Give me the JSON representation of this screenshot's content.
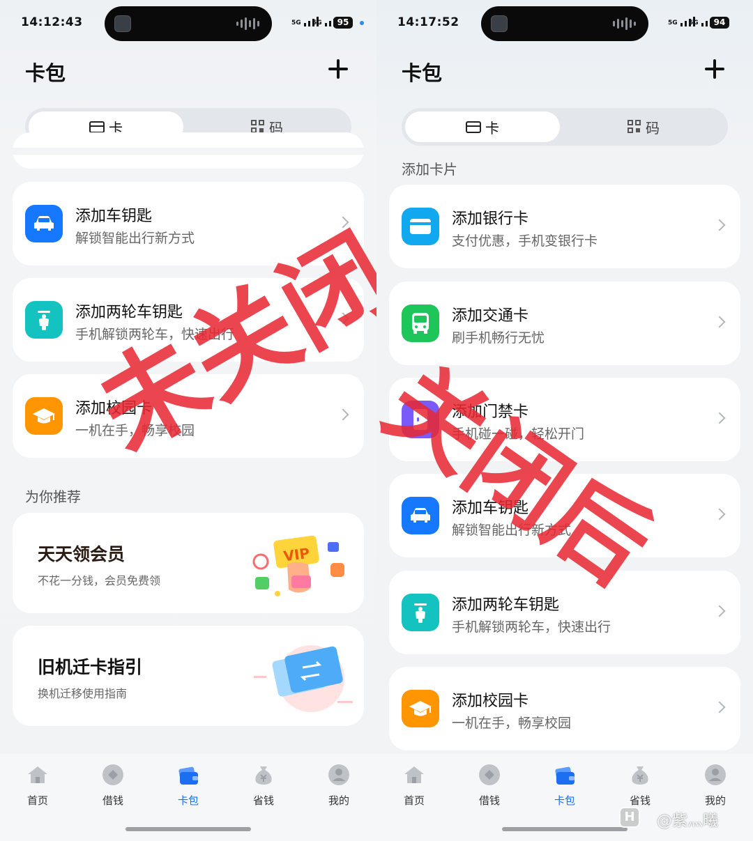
{
  "left": {
    "time": "14:12:43",
    "battery": "95",
    "title": "卡包",
    "segment": {
      "card": "卡",
      "code": "码"
    },
    "items": [
      {
        "title": "添加车钥匙",
        "subtitle": "解锁智能出行新方式",
        "icon": "car-icon",
        "color": "#1677ff"
      },
      {
        "title": "添加两轮车钥匙",
        "subtitle": "手机解锁两轮车，快速出行",
        "icon": "scooter-icon",
        "color": "#14c2c0"
      },
      {
        "title": "添加校园卡",
        "subtitle": "一机在手，畅享校园",
        "icon": "graduation-cap-icon",
        "color": "#ff9500"
      }
    ],
    "recommend_title": "为你推荐",
    "promos": [
      {
        "title": "天天领会员",
        "subtitle": "不花一分钱，会员免费领",
        "badge": "VIP"
      },
      {
        "title": "旧机迁卡指引",
        "subtitle": "换机迁移使用指南"
      }
    ],
    "stamp": "未关闭"
  },
  "right": {
    "time": "14:17:52",
    "battery": "94",
    "title": "卡包",
    "segment": {
      "card": "卡",
      "code": "码"
    },
    "section_title": "添加卡片",
    "items": [
      {
        "title": "添加银行卡",
        "subtitle": "支付优惠，手机变银行卡",
        "icon": "bank-card-icon",
        "color": "#12a8ef"
      },
      {
        "title": "添加交通卡",
        "subtitle": "刷手机畅行无忧",
        "icon": "bus-icon",
        "color": "#1dc55a"
      },
      {
        "title": "添加门禁卡",
        "subtitle": "手机碰一碰，轻松开门",
        "icon": "door-icon",
        "color": "#7a5af8"
      },
      {
        "title": "添加车钥匙",
        "subtitle": "解锁智能出行新方式",
        "icon": "car-icon",
        "color": "#1677ff"
      },
      {
        "title": "添加两轮车钥匙",
        "subtitle": "手机解锁两轮车，快速出行",
        "icon": "scooter-icon",
        "color": "#14c2c0"
      },
      {
        "title": "添加校园卡",
        "subtitle": "一机在手，畅享校园",
        "icon": "graduation-cap-icon",
        "color": "#ff9500"
      }
    ],
    "stamp": "关闭后"
  },
  "tabs": [
    {
      "label": "首页",
      "icon": "home-icon"
    },
    {
      "label": "借钱",
      "icon": "borrow-icon"
    },
    {
      "label": "卡包",
      "icon": "wallet-icon",
      "active": true
    },
    {
      "label": "省钱",
      "icon": "money-bag-icon"
    },
    {
      "label": "我的",
      "icon": "profile-icon"
    }
  ],
  "signal_label": "5G",
  "watermark": "@紫灬曦",
  "watermark_badge": "H",
  "colors": {
    "accent": "#1d6ff2",
    "stamp": "#e82832"
  }
}
